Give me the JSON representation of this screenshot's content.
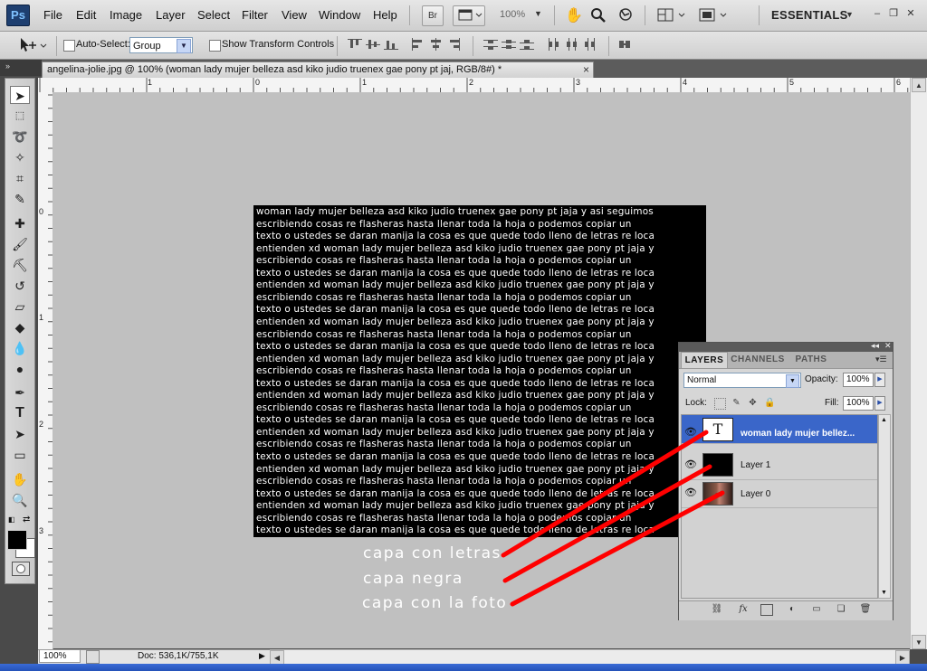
{
  "app": {
    "logo": "Ps",
    "workspace": "ESSENTIALS",
    "zoom": "100%"
  },
  "menu": [
    "File",
    "Edit",
    "Image",
    "Layer",
    "Select",
    "Filter",
    "View",
    "Window",
    "Help"
  ],
  "menubar_buttons": {
    "bridge": "Br"
  },
  "options": {
    "auto_select_label": "Auto-Select:",
    "auto_select_value": "Group",
    "show_transform_label": "Show Transform Controls"
  },
  "document": {
    "tab_title": "angelina-jolie.jpg @ 100% (woman lady mujer belleza asd kiko judio truenex gae pony pt jaj, RGB/8#) *",
    "close_glyph": "×",
    "text_lines": [
      "woman lady mujer belleza asd kiko judio truenex gae pony pt jaja y asi seguimos",
      "escribiendo cosas re flasheras hasta llenar toda la hoja o podemos copiar un",
      "texto o ustedes se daran manija la cosa es que quede todo lleno de letras re loca",
      "entienden xd woman lady mujer belleza asd kiko judio truenex gae pony pt jaja y",
      "escribiendo cosas re flasheras hasta llenar toda la hoja o podemos copiar un",
      "texto o ustedes se daran manija la cosa es que quede todo lleno de letras re loca",
      "entienden xd woman lady mujer belleza asd kiko judio truenex gae pony pt jaja y",
      "escribiendo cosas re flasheras hasta llenar toda la hoja o podemos copiar un",
      "texto o ustedes se daran manija la cosa es que quede todo lleno de letras re loca",
      "entienden xd woman lady mujer belleza asd kiko judio truenex gae pony pt jaja y",
      "escribiendo cosas re flasheras hasta llenar toda la hoja o podemos copiar un",
      "texto o ustedes se daran manija la cosa es que quede todo lleno de letras re loca",
      "entienden xd woman lady mujer belleza asd kiko judio truenex gae pony pt jaja y",
      "escribiendo cosas re flasheras hasta llenar toda la hoja o podemos copiar un",
      "texto o ustedes se daran manija la cosa es que quede todo lleno de letras re loca",
      "entienden xd woman lady mujer belleza asd kiko judio truenex gae pony pt jaja y",
      "escribiendo cosas re flasheras hasta llenar toda la hoja o podemos copiar un",
      "texto o ustedes se daran manija la cosa es que quede todo lleno de letras re loca",
      "entienden xd woman lady mujer belleza asd kiko judio truenex gae pony pt jaja y",
      "escribiendo cosas re flasheras hasta llenar toda la hoja o podemos copiar un",
      "texto o ustedes se daran manija la cosa es que quede todo lleno de letras re loca",
      "entienden xd woman lady mujer belleza asd kiko judio truenex gae pony pt jaja y",
      "escribiendo cosas re flasheras hasta llenar toda la hoja o podemos copiar un",
      "texto o ustedes se daran manija la cosa es que quede todo lleno de letras re loca",
      "entienden xd woman lady mujer belleza asd kiko judio truenex gae pony pt jaja y",
      "escribiendo cosas re flasheras hasta llenar toda la hoja o podemos copiar un",
      "texto o ustedes se daran manija la cosa es que quede todo lleno de letras re loca"
    ]
  },
  "annotations": {
    "layer_text": "capa con letras",
    "layer_black": "capa negra",
    "layer_photo": "capa con la foto",
    "arrow_color": "#ff0000"
  },
  "rulers": {
    "top": [
      "1",
      "0",
      "1",
      "2",
      "3",
      "4",
      "5",
      "6"
    ],
    "left": [
      "0",
      "1",
      "2",
      "3"
    ]
  },
  "status": {
    "zoom": "100%",
    "doc": "Doc: 536,1K/755,1K"
  },
  "layers_panel": {
    "tabs": [
      "LAYERS",
      "CHANNELS",
      "PATHS"
    ],
    "blend_mode": "Normal",
    "opacity_label": "Opacity:",
    "opacity": "100%",
    "lock_label": "Lock:",
    "fill_label": "Fill:",
    "fill": "100%",
    "layers": [
      {
        "name": "woman lady mujer bellez...",
        "thumb": "T",
        "selected": true
      },
      {
        "name": "Layer 1",
        "thumb": "",
        "selected": false
      },
      {
        "name": "Layer 0",
        "thumb": "",
        "selected": false
      }
    ]
  },
  "colors": {
    "selection": "#3a66c9",
    "canvas": "#c0c0c0",
    "accent_logo": "#1e3f70"
  }
}
